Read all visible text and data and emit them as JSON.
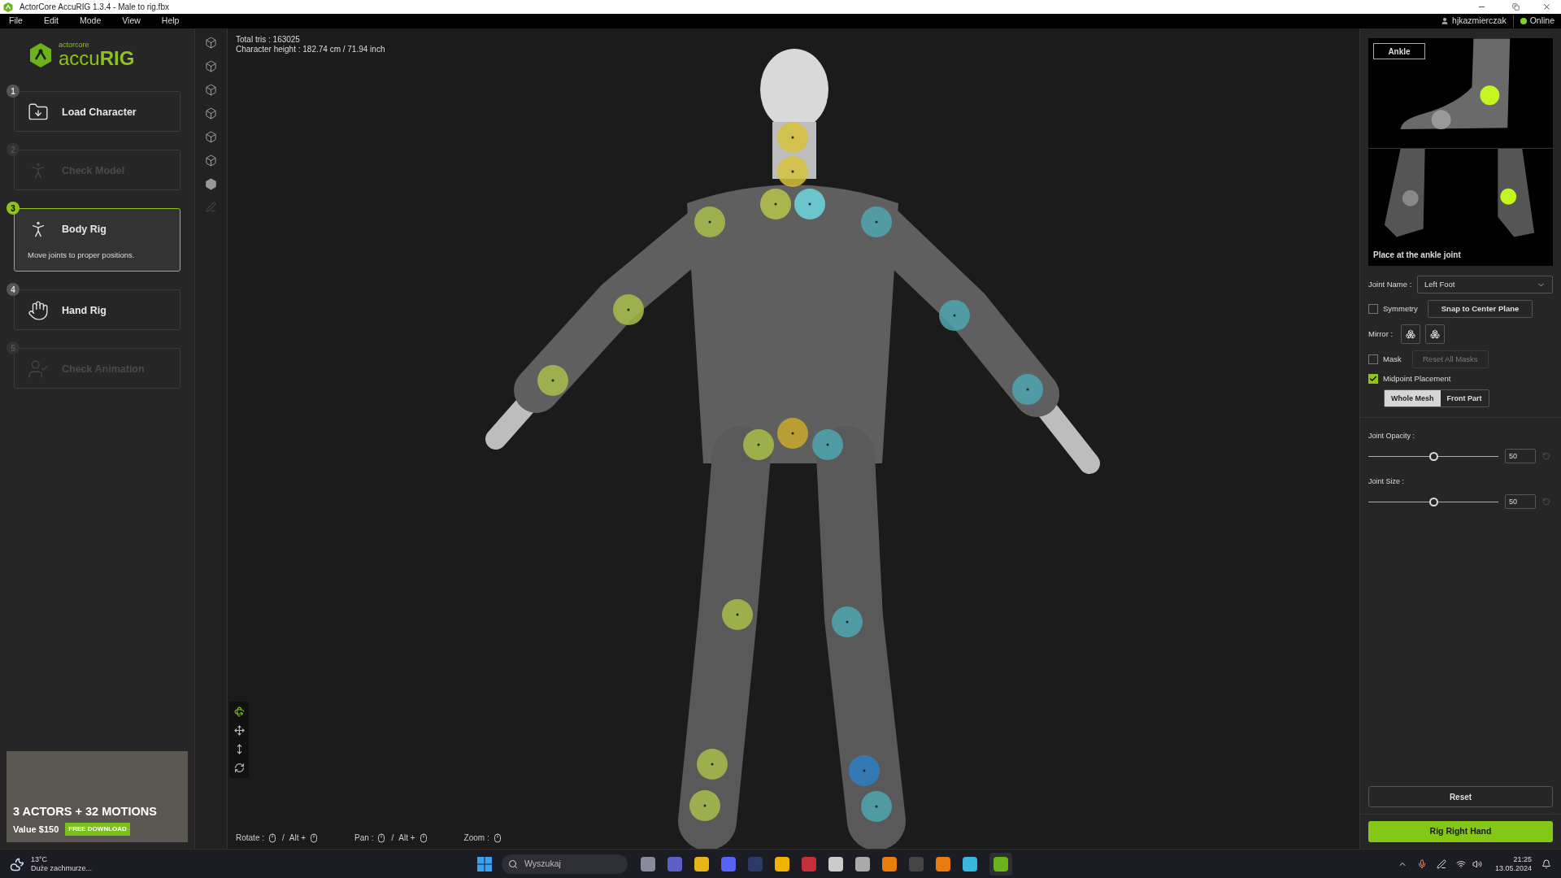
{
  "window": {
    "title": "ActorCore AccuRIG 1.3.4 - Male to rig.fbx"
  },
  "menu": [
    "File",
    "Edit",
    "Mode",
    "View",
    "Help"
  ],
  "account": {
    "user": "hjkazmierczak",
    "status": "Online"
  },
  "logo": {
    "small": "actorcore",
    "large": "accu**RIG**"
  },
  "steps": [
    {
      "kind": "load",
      "number": "1",
      "label": "Load Character",
      "disabled": false,
      "selected": false
    },
    {
      "kind": "check",
      "number": "2",
      "label": "Check Model",
      "disabled": true,
      "selected": false
    },
    {
      "kind": "body",
      "number": "3",
      "label": "Body Rig",
      "description": "Move joints to proper positions.",
      "disabled": false,
      "selected": true
    },
    {
      "kind": "hand",
      "number": "4",
      "label": "Hand Rig",
      "disabled": false,
      "selected": false
    },
    {
      "kind": "animation",
      "number": "5",
      "label": "Check Animation",
      "disabled": true,
      "selected": false
    }
  ],
  "promo": {
    "headline": "3 ACTORS + 32 MOTIONS",
    "value": "Value $150",
    "button": "FREE DOWNLOAD"
  },
  "viewport": {
    "stats": [
      "Total tris : 163025",
      "Character height : 182.74 cm / 71.94 inch"
    ],
    "hints": [
      {
        "label": "Rotate :",
        "separator": "/",
        "alt": "Alt +"
      },
      {
        "label": "Pan :",
        "separator": "/",
        "alt": "Alt +"
      },
      {
        "label": "Zoom :"
      }
    ]
  },
  "panel": {
    "reference": {
      "title": "Ankle",
      "caption": "Place at the ankle joint"
    },
    "joint_name": {
      "label": "Joint Name :",
      "value": "Left Foot"
    },
    "symmetry": {
      "label": "Symmetry",
      "checked": false
    },
    "snap_button": "Snap to Center Plane",
    "mirror_label": "Mirror :",
    "mask": {
      "label": "Mask",
      "checked": false
    },
    "reset_masks": {
      "label": "Reset All Masks",
      "disabled": true
    },
    "midpoint": {
      "label": "Midpoint Placement",
      "checked": true
    },
    "placement_options": [
      {
        "label": "Whole Mesh",
        "selected": true
      },
      {
        "label": "Front Part",
        "selected": false
      }
    ],
    "sliders": [
      {
        "label": "Joint Opacity :",
        "level": 0.5,
        "value": "50"
      },
      {
        "label": "Joint Size :",
        "level": 0.5,
        "value": "50"
      }
    ],
    "reset_button": "Reset",
    "primary_button": "Rig Right Hand"
  },
  "taskbar": {
    "weather": {
      "temp": "13°C",
      "text": "Duże zachmurze..."
    },
    "search": {
      "placeholder": "Wyszukaj"
    },
    "time": "21:25",
    "date": "13.05.2024"
  }
}
